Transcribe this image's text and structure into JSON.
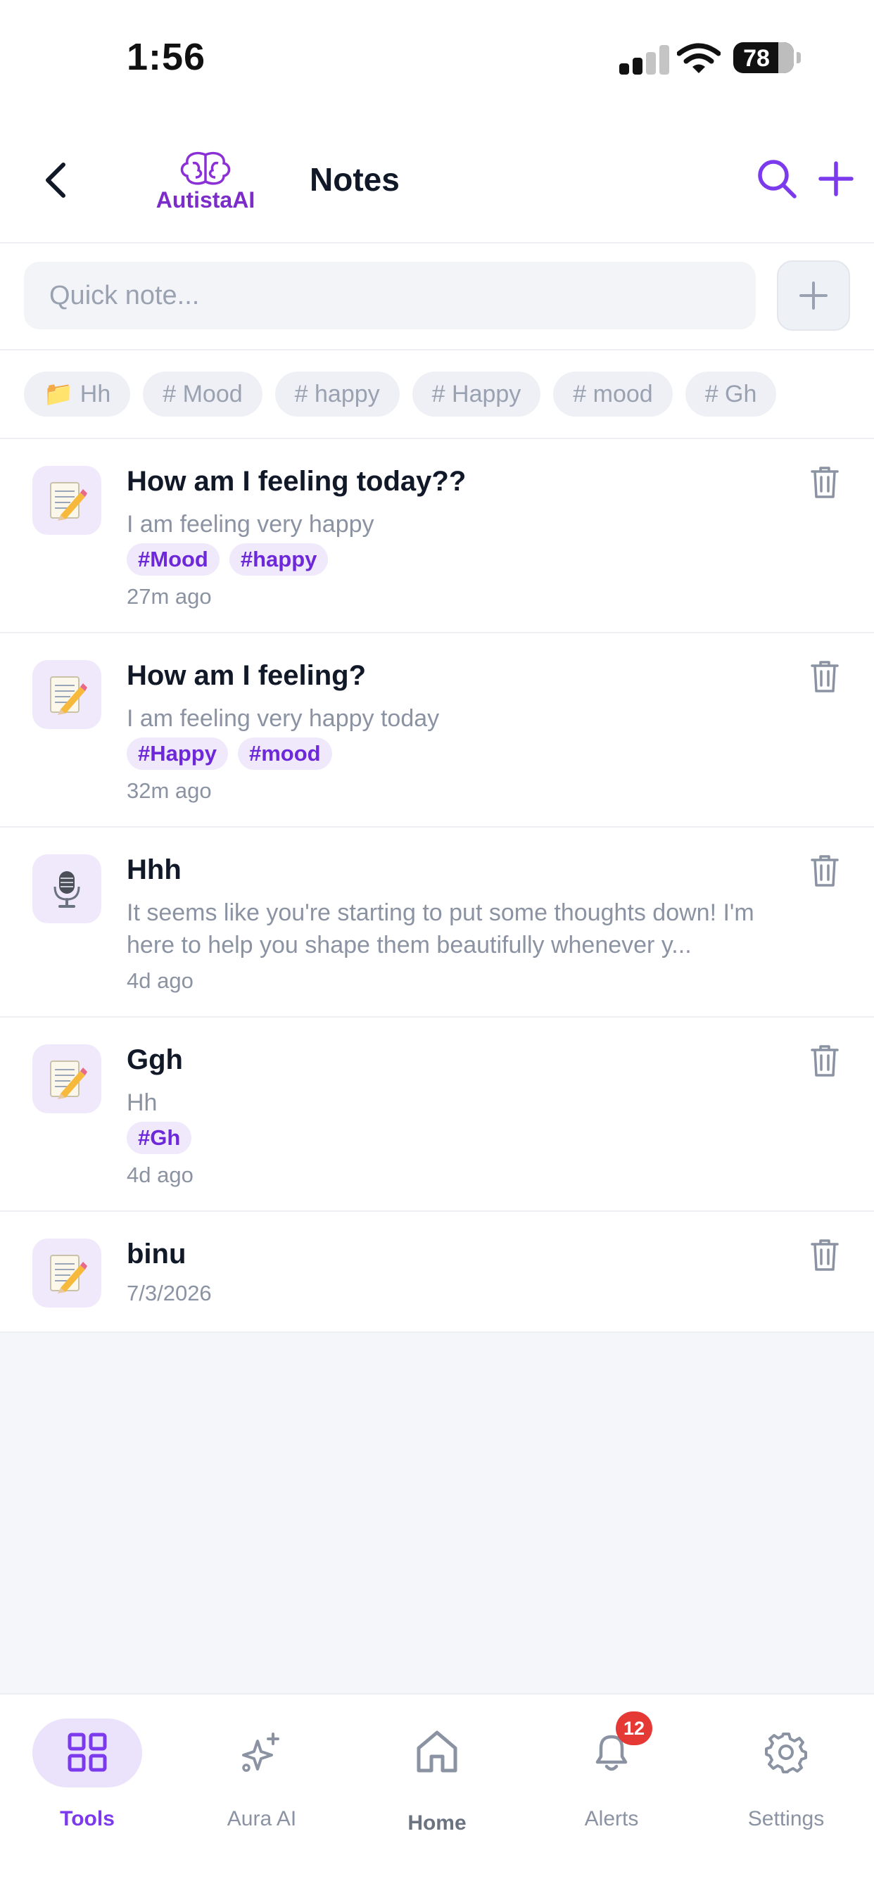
{
  "status_bar": {
    "time": "1:56",
    "battery": "78"
  },
  "header": {
    "back_icon": "chevron-left-icon",
    "logo_text": "AutistaAI",
    "title": "Notes",
    "search_icon": "search-icon",
    "add_icon": "plus-icon"
  },
  "quick_note": {
    "placeholder": "Quick note..."
  },
  "filters": [
    {
      "label": "📁 Hh"
    },
    {
      "label": "# Mood"
    },
    {
      "label": "# happy"
    },
    {
      "label": "# Happy"
    },
    {
      "label": "# mood"
    },
    {
      "label": "# Gh"
    }
  ],
  "notes": [
    {
      "icon": "memo-pencil-icon",
      "title": "How am I feeling today??",
      "body": "I am feeling very happy",
      "tags": [
        "#Mood",
        "#happy"
      ],
      "time": "27m ago"
    },
    {
      "icon": "memo-pencil-icon",
      "title": "How am I feeling?",
      "body": "I am feeling very happy today",
      "tags": [
        "#Happy",
        "#mood"
      ],
      "time": "32m ago"
    },
    {
      "icon": "microphone-icon",
      "title": "Hhh",
      "body": "It seems like you're starting to put some thoughts down! I'm here to help you shape them beautifully whenever y...",
      "tags": [],
      "time": "4d ago"
    },
    {
      "icon": "memo-pencil-icon",
      "title": "Ggh",
      "body": "Hh",
      "tags": [
        "#Gh"
      ],
      "time": "4d ago"
    },
    {
      "icon": "memo-pencil-icon",
      "title": "binu",
      "body": "",
      "tags": [],
      "time": "7/3/2026"
    }
  ],
  "tabbar": {
    "tools": "Tools",
    "aura": "Aura AI",
    "home": "Home",
    "alerts": "Alerts",
    "alerts_badge": "12",
    "settings": "Settings"
  },
  "colors": {
    "accent": "#7c3aed",
    "tag_bg": "#efe9fb",
    "badge": "#e53935",
    "muted": "#8b93a3"
  }
}
